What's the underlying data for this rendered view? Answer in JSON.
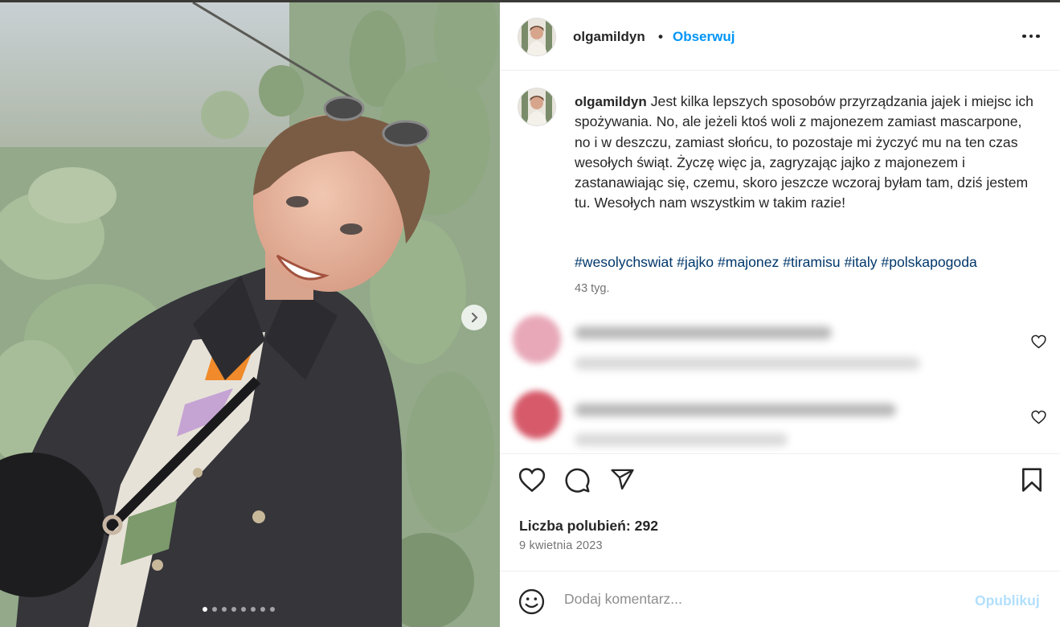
{
  "post": {
    "username": "olgamildyn",
    "separator": "•",
    "follow_label": "Obserwuj",
    "more_icon": "more-horizontal-icon"
  },
  "caption": {
    "username": "olgamildyn",
    "text": "Jest kilka lepszych sposobów przyrządzania jajek i miejsc ich spożywania. No, ale jeżeli ktoś woli z majonezem zamiast mascarpone, no i w deszczu, zamiast słońcu, to pozostaje mi życzyć mu na ten czas wesołych świąt. Życzę więc ja, zagryzając jajko z majonezem i zastanawiając się, czemu, skoro jeszcze wczoraj byłam tam, dziś jestem tu. Wesołych nam wszystkim w takim razie!",
    "hashtags": [
      "#wesolychswiat",
      "#jajko",
      "#majonez",
      "#tiramisu",
      "#italy",
      "#polskapogoda"
    ],
    "age": "43 tyg."
  },
  "comments": [
    {
      "avatar_color": "#e8a8b8",
      "blurred": true
    },
    {
      "avatar_color": "#d65a6a",
      "blurred": true
    }
  ],
  "actions": {
    "like_icon": "heart-icon",
    "comment_icon": "comment-icon",
    "share_icon": "send-icon",
    "save_icon": "bookmark-icon"
  },
  "likes_text": "Liczba polubień: 292",
  "date_text": "9 kwietnia 2023",
  "add_comment": {
    "placeholder": "Dodaj komentarz...",
    "publish_label": "Opublikuj"
  },
  "carousel": {
    "total": 8,
    "active_index": 0
  },
  "colors": {
    "link_blue": "#0095f6",
    "hashtag": "#00376b",
    "publish_disabled": "#b2dffc",
    "muted": "#737373"
  }
}
